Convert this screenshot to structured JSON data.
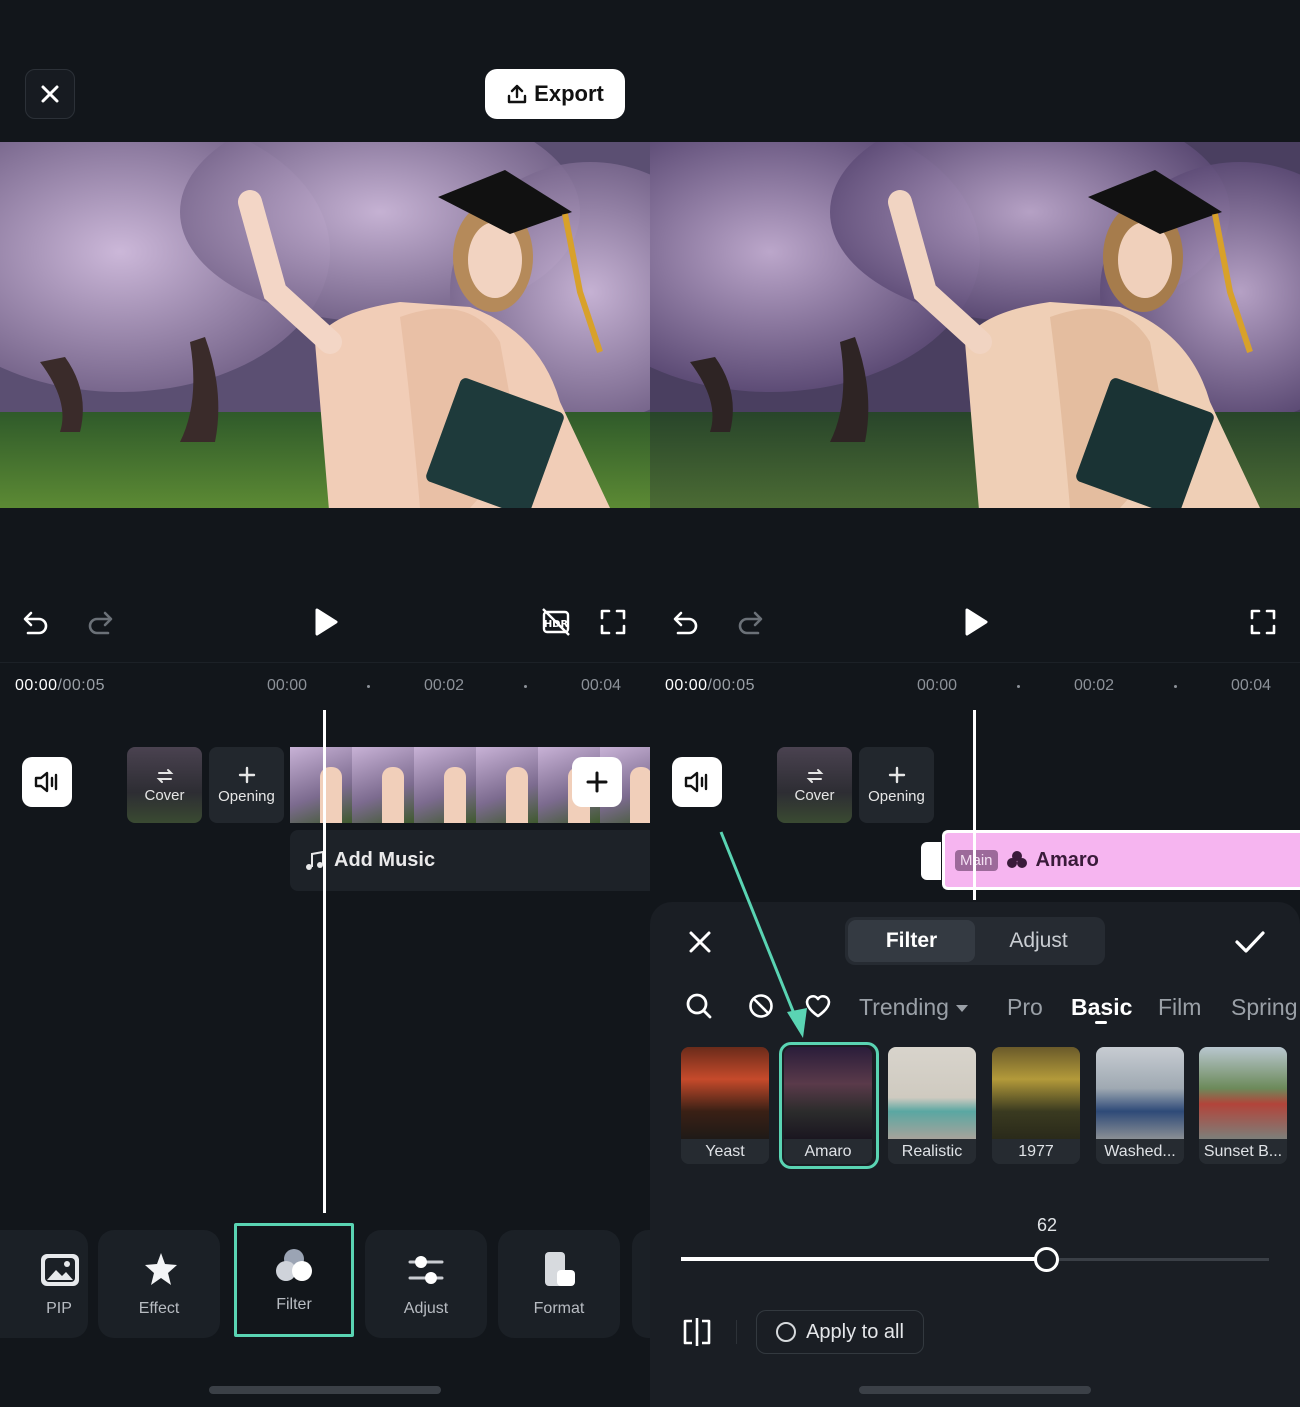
{
  "left_panel": {
    "export_label": "Export",
    "timecode_current": "00:00",
    "timecode_total": "/00:05",
    "ticks": [
      "00:00",
      "00:02",
      "00:04"
    ],
    "cover_label": "Cover",
    "opening_label": "Opening",
    "add_music_label": "Add Music",
    "tools": [
      {
        "label": "PIP"
      },
      {
        "label": "Effect"
      },
      {
        "label": "Filter"
      },
      {
        "label": "Adjust"
      },
      {
        "label": "Format"
      }
    ]
  },
  "right_panel": {
    "timecode_current": "00:00",
    "timecode_total": "/00:05",
    "ticks": [
      "00:00",
      "00:02",
      "00:04"
    ],
    "cover_label": "Cover",
    "opening_label": "Opening",
    "track_badge": "Main",
    "track_filter": "Amaro",
    "sheet_tabs": {
      "filter": "Filter",
      "adjust": "Adjust"
    },
    "categories": [
      "Trending",
      "Pro",
      "Basic",
      "Film",
      "Spring"
    ],
    "active_category": "Basic",
    "filters": [
      {
        "label": "Yeast"
      },
      {
        "label": "Amaro"
      },
      {
        "label": "Realistic"
      },
      {
        "label": "1977"
      },
      {
        "label": "Washed..."
      },
      {
        "label": "Sunset B..."
      }
    ],
    "selected_filter": "Amaro",
    "intensity_value": "62",
    "intensity": 0.62,
    "apply_all_label": "Apply to all"
  },
  "colors": {
    "accent": "#5ad4b3",
    "track_pink": "#f6b5f0",
    "background": "#12161b"
  }
}
